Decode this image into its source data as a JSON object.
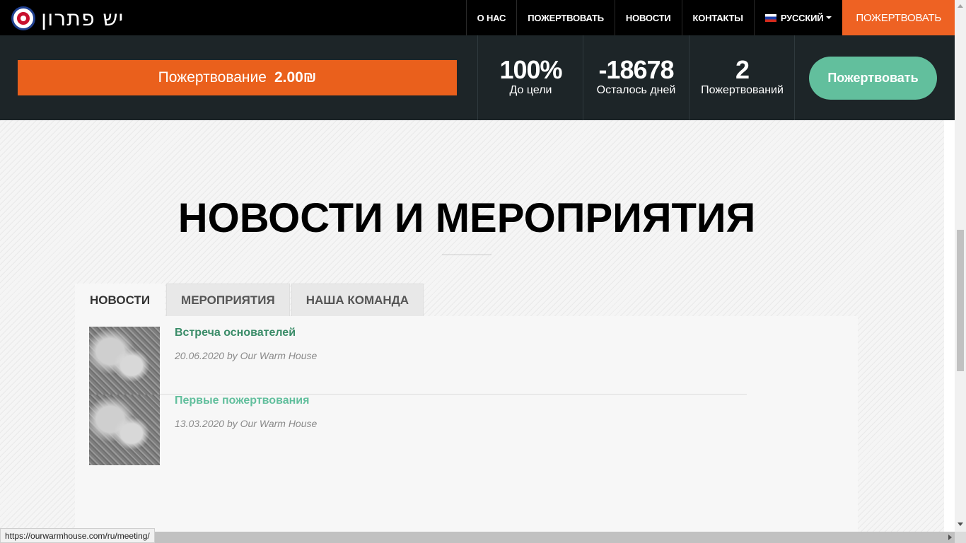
{
  "header": {
    "logo_text": "יש פתרון",
    "nav": {
      "about": "О НАС",
      "donate": "ПОЖЕРТВОВАТЬ",
      "news": "НОВОСТИ",
      "contacts": "КОНТАКТЫ",
      "language": "РУССКИЙ",
      "cta": "ПОЖЕРТВОВАТЬ"
    }
  },
  "stats": {
    "progress_label": "Пожертвование",
    "progress_amount": "2.00₪",
    "goal_value": "100%",
    "goal_label": "До цели",
    "days_value": "-18678",
    "days_label": "Осталось дней",
    "donations_value": "2",
    "donations_label": "Пожертвований",
    "donate_button": "Пожертвовать"
  },
  "section": {
    "title": "НОВОСТИ И МЕРОПРИЯТИЯ",
    "tabs": [
      "НОВОСТИ",
      "МЕРОПРИЯТИЯ",
      "НАША КОМАНДА"
    ],
    "news": [
      {
        "title": "Встреча основателей",
        "meta": "20.06.2020 by Our Warm House"
      },
      {
        "title": "Первые пожертвования",
        "meta": "13.03.2020 by Our Warm House"
      }
    ]
  },
  "status_url": "https://ourwarmhouse.com/ru/meeting/",
  "colors": {
    "accent_orange": "#ea601c",
    "accent_green": "#62bf9d",
    "dark_bar": "#1d2528"
  }
}
